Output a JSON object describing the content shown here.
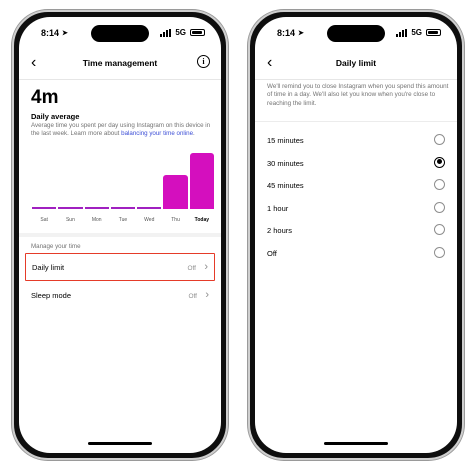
{
  "status": {
    "time": "8:14",
    "network": "5G"
  },
  "left": {
    "header": {
      "title": "Time management",
      "back_icon": "chevron-left-icon",
      "info_icon": "info-icon"
    },
    "summary": {
      "value": "4m",
      "label": "Daily average",
      "description": "Average time you spent per day using Instagram on this device in the last week. Learn more about ",
      "link": "balancing your time online",
      "link_suffix": "."
    },
    "chart_data": {
      "type": "bar",
      "categories": [
        "Sat",
        "Sun",
        "Mon",
        "Tue",
        "Wed",
        "Thu",
        "Today"
      ],
      "values": [
        0,
        0,
        0,
        0,
        0,
        0.6,
        1.0
      ],
      "highlight": "Today",
      "colors": {
        "bar": "#d40fbe",
        "baseline": "#a020c0"
      }
    },
    "manage": {
      "section_label": "Manage your time",
      "rows": [
        {
          "label": "Daily limit",
          "value": "Off",
          "highlighted": true
        },
        {
          "label": "Sleep mode",
          "value": "Off",
          "highlighted": false
        }
      ]
    }
  },
  "right": {
    "header": {
      "title": "Daily limit",
      "back_icon": "chevron-left-icon"
    },
    "intro": "We'll remind you to close Instagram when you spend this amount of time in a day. We'll also let you know when you're close to reaching the limit.",
    "options": [
      {
        "label": "15 minutes",
        "selected": false
      },
      {
        "label": "30 minutes",
        "selected": true
      },
      {
        "label": "45 minutes",
        "selected": false
      },
      {
        "label": "1 hour",
        "selected": false
      },
      {
        "label": "2 hours",
        "selected": false
      },
      {
        "label": "Off",
        "selected": false
      }
    ]
  },
  "colors": {
    "accent": "#d40fbe",
    "link": "#3d4fd6",
    "highlight_border": "#e53b29"
  }
}
